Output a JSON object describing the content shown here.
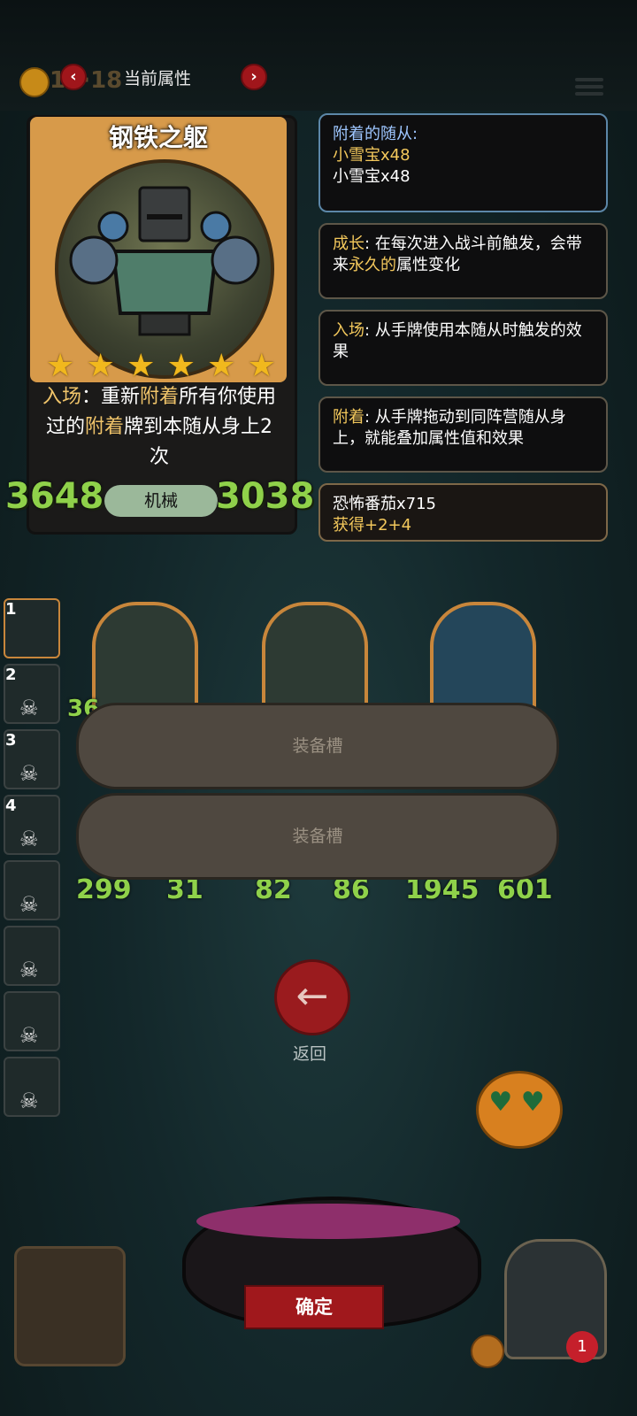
{
  "header": {
    "coins": "15",
    "coins_max": "18",
    "title": "当前属性",
    "prev_icon": "chevron-left-icon",
    "next_icon": "chevron-right-icon"
  },
  "card": {
    "name": "钢铁之躯",
    "stars": 6,
    "ability_parts": [
      "入场",
      "：重新",
      "附着",
      "所有你使用过的",
      "附着",
      "牌到本随从身上2次"
    ],
    "attack": "3648",
    "health": "3038",
    "tribe": "机械"
  },
  "info_boxes": {
    "attached_title": "附着的随从:",
    "attached_1": "小雪宝x48",
    "attached_2": "小雪宝x48",
    "growth_kw": "成长",
    "growth_text_a": ": 在每次进入战斗前触发，会带来",
    "growth_kw2": "永久的",
    "growth_text_b": "属性变化",
    "entry_kw": "入场",
    "entry_text": ": 从手牌使用本随从时触发的效果",
    "attach_kw": "附着",
    "attach_text": ": 从手牌拖动到同阵营随从身上，就能叠加属性值和效果",
    "buff_title": "恐怖番茄x715",
    "buff_value": "获得+2+4"
  },
  "side_slots": [
    "1",
    "2",
    "3",
    "4"
  ],
  "board": [
    {
      "atk": "299",
      "hp": "31"
    },
    {
      "atk": "82",
      "hp": "86"
    },
    {
      "atk": "1945",
      "hp": "601"
    }
  ],
  "board_partial_stat": "36",
  "slots": {
    "slot1": "装备槽",
    "slot2": "装备槽"
  },
  "back": {
    "label": "返回",
    "icon": "arrow-left-icon"
  },
  "confirm": "确定",
  "hero": {
    "lives": "1"
  }
}
